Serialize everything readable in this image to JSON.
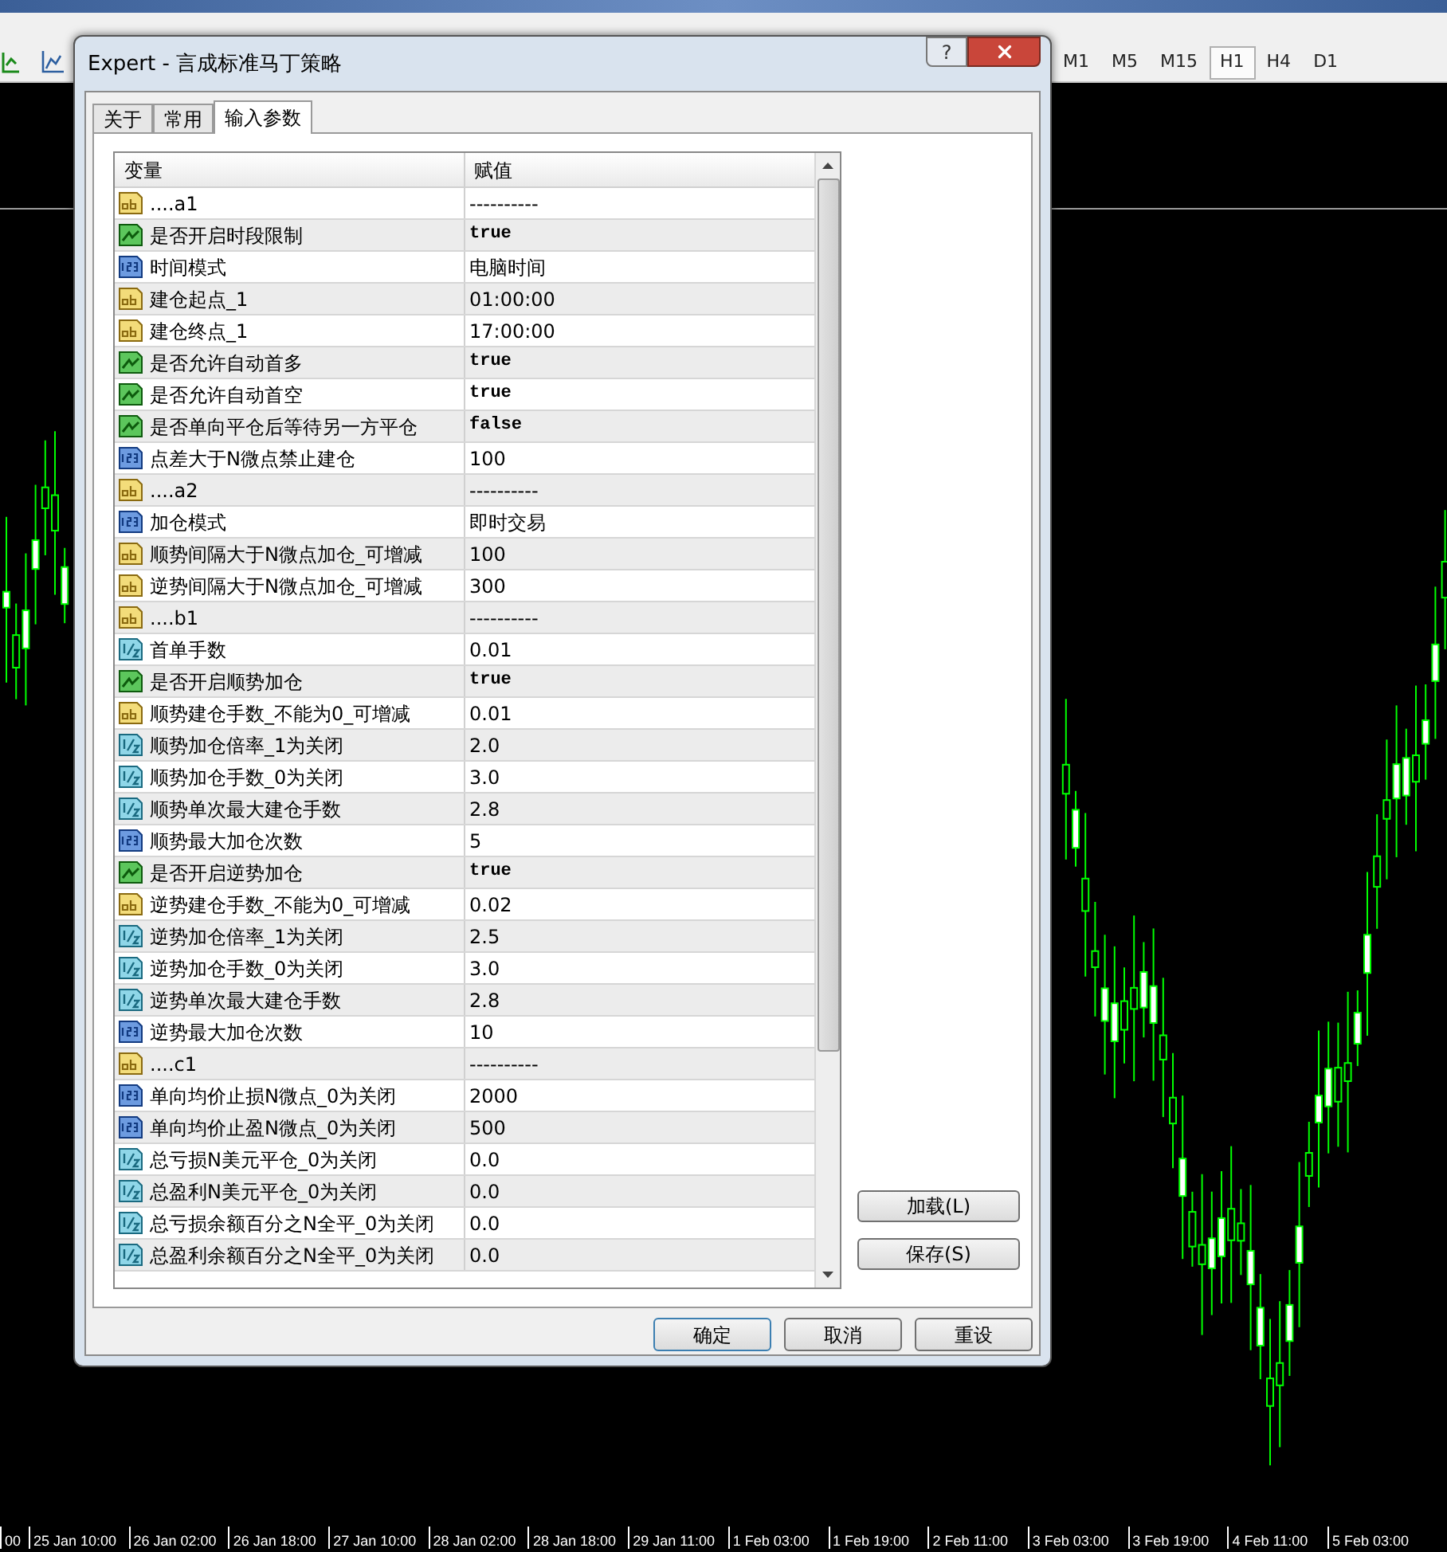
{
  "toolbar": {
    "timeframes": [
      {
        "label": "M1",
        "selected": false
      },
      {
        "label": "M5",
        "selected": false
      },
      {
        "label": "M15",
        "selected": false
      },
      {
        "label": "H1",
        "selected": true
      },
      {
        "label": "H4",
        "selected": false
      },
      {
        "label": "D1",
        "selected": false
      }
    ]
  },
  "time_axis": {
    "labels": [
      "00",
      "25 Jan 10:00",
      "26 Jan 02:00",
      "26 Jan 18:00",
      "27 Jan 10:00",
      "28 Jan 02:00",
      "28 Jan 18:00",
      "29 Jan 11:00",
      "1 Feb 03:00",
      "1 Feb 19:00",
      "2 Feb 11:00",
      "3 Feb 03:00",
      "3 Feb 19:00",
      "4 Feb 11:00",
      "5 Feb 03:00"
    ]
  },
  "dialog": {
    "title": "Expert - 言成标准马丁策略",
    "help": "?",
    "tabs": [
      {
        "label": "关于",
        "selected": false
      },
      {
        "label": "常用",
        "selected": false
      },
      {
        "label": "输入参数",
        "selected": true
      }
    ],
    "table": {
      "columns": [
        "变量",
        "赋值"
      ],
      "rows": [
        {
          "kind": "string",
          "name": "....a1",
          "value": "----------"
        },
        {
          "kind": "bool",
          "name": "是否开启时段限制",
          "value": "true"
        },
        {
          "kind": "int",
          "name": "时间模式",
          "value": "电脑时间"
        },
        {
          "kind": "string",
          "name": "建仓起点_1",
          "value": "01:00:00"
        },
        {
          "kind": "string",
          "name": "建仓终点_1",
          "value": "17:00:00"
        },
        {
          "kind": "bool",
          "name": "是否允许自动首多",
          "value": "true"
        },
        {
          "kind": "bool",
          "name": "是否允许自动首空",
          "value": "true"
        },
        {
          "kind": "bool",
          "name": "是否单向平仓后等待另一方平仓",
          "value": "false"
        },
        {
          "kind": "int",
          "name": "点差大于N微点禁止建仓",
          "value": "100"
        },
        {
          "kind": "string",
          "name": "....a2",
          "value": "----------"
        },
        {
          "kind": "int",
          "name": "加仓模式",
          "value": "即时交易"
        },
        {
          "kind": "string",
          "name": "顺势间隔大于N微点加仓_可增减",
          "value": "100"
        },
        {
          "kind": "string",
          "name": "逆势间隔大于N微点加仓_可增减",
          "value": "300"
        },
        {
          "kind": "string",
          "name": "....b1",
          "value": "----------"
        },
        {
          "kind": "double",
          "name": "首单手数",
          "value": "0.01"
        },
        {
          "kind": "bool",
          "name": "是否开启顺势加仓",
          "value": "true"
        },
        {
          "kind": "string",
          "name": "顺势建仓手数_不能为0_可增减",
          "value": "0.01"
        },
        {
          "kind": "double",
          "name": "顺势加仓倍率_1为关闭",
          "value": "2.0"
        },
        {
          "kind": "double",
          "name": "顺势加仓手数_0为关闭",
          "value": "3.0"
        },
        {
          "kind": "double",
          "name": "顺势单次最大建仓手数",
          "value": "2.8"
        },
        {
          "kind": "int",
          "name": "顺势最大加仓次数",
          "value": "5"
        },
        {
          "kind": "bool",
          "name": "是否开启逆势加仓",
          "value": "true"
        },
        {
          "kind": "string",
          "name": "逆势建仓手数_不能为0_可增减",
          "value": "0.02"
        },
        {
          "kind": "double",
          "name": "逆势加仓倍率_1为关闭",
          "value": "2.5"
        },
        {
          "kind": "double",
          "name": "逆势加仓手数_0为关闭",
          "value": "3.0"
        },
        {
          "kind": "double",
          "name": "逆势单次最大建仓手数",
          "value": "2.8"
        },
        {
          "kind": "int",
          "name": "逆势最大加仓次数",
          "value": "10"
        },
        {
          "kind": "string",
          "name": "....c1",
          "value": "----------"
        },
        {
          "kind": "int",
          "name": "单向均价止损N微点_0为关闭",
          "value": "2000"
        },
        {
          "kind": "int",
          "name": "单向均价止盈N微点_0为关闭",
          "value": "500"
        },
        {
          "kind": "double",
          "name": "总亏损N美元平仓_0为关闭",
          "value": "0.0"
        },
        {
          "kind": "double",
          "name": "总盈利N美元平仓_0为关闭",
          "value": "0.0"
        },
        {
          "kind": "double",
          "name": "总亏损余额百分之N全平_0为关闭",
          "value": "0.0"
        },
        {
          "kind": "double",
          "name": "总盈利余额百分之N全平_0为关闭",
          "value": "0.0"
        }
      ]
    },
    "side_buttons": [
      "加载(L)",
      "保存(S)"
    ],
    "buttons": [
      "确定",
      "取消",
      "重设"
    ]
  }
}
